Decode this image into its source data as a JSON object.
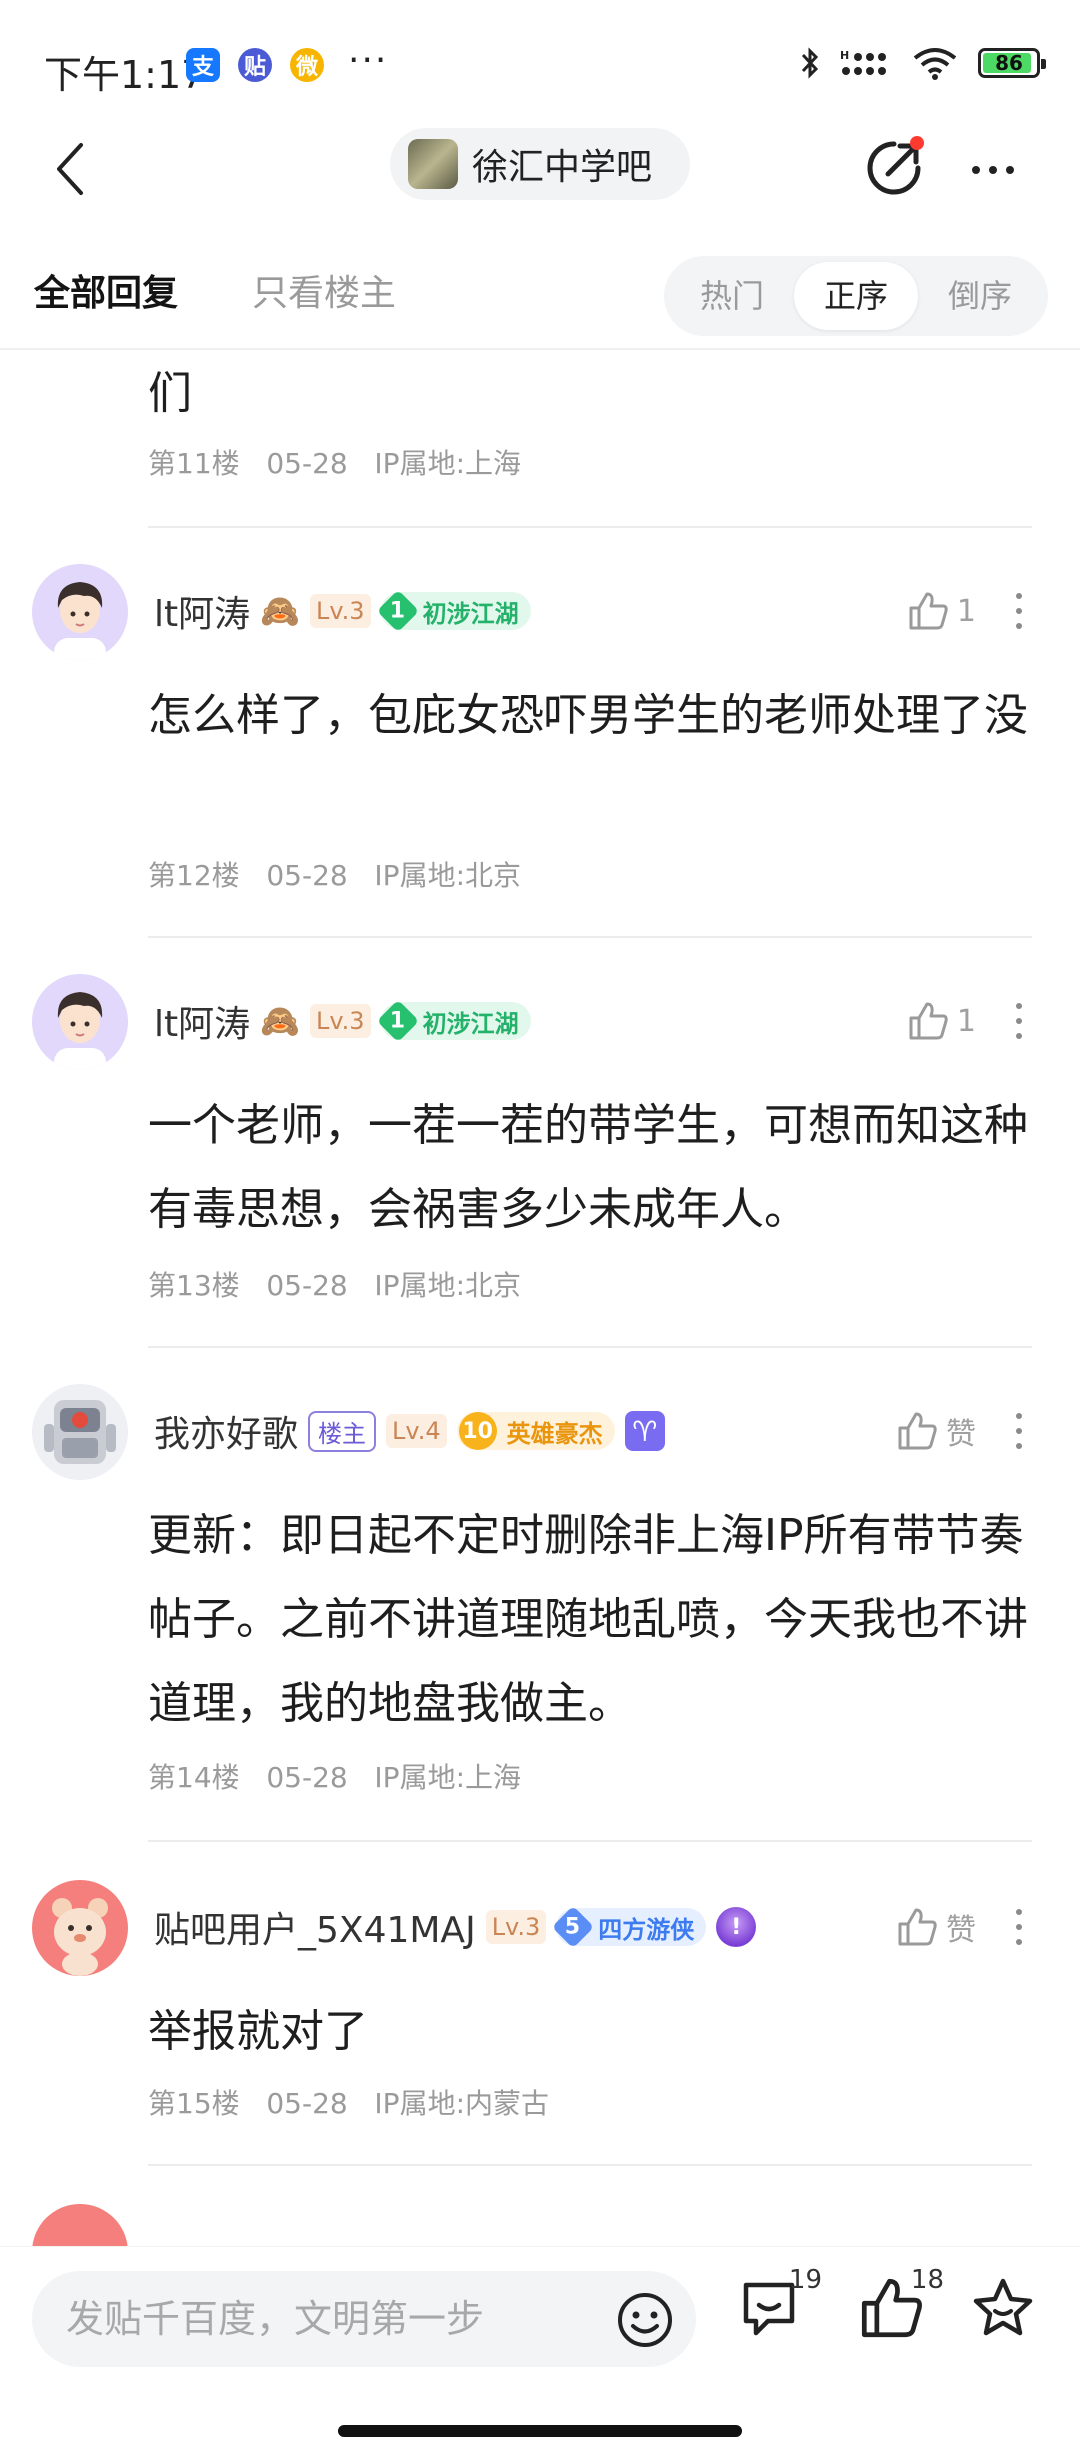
{
  "status_bar": {
    "time": "下午1:17",
    "app_icons": [
      "支",
      "贴",
      "微"
    ],
    "more": "···",
    "battery": "86"
  },
  "header": {
    "forum_name": "徐汇中学吧"
  },
  "tabs": {
    "all": "全部回复",
    "host_only": "只看楼主",
    "sort": [
      "热门",
      "正序",
      "倒序"
    ],
    "sort_active": "正序"
  },
  "posts": [
    {
      "content": "们",
      "floor": "第11楼",
      "date": "05-28",
      "ip": "IP属地:上海"
    },
    {
      "username": "lt阿涛",
      "emoji": "🙈",
      "level": "Lv.3",
      "rank_num": "1",
      "rank_name": "初涉江湖",
      "likes": "1",
      "content": "怎么样了，包庇女恐吓男学生的老师处理了没",
      "floor": "第12楼",
      "date": "05-28",
      "ip": "IP属地:北京"
    },
    {
      "username": "lt阿涛",
      "emoji": "🙈",
      "level": "Lv.3",
      "rank_num": "1",
      "rank_name": "初涉江湖",
      "likes": "1",
      "content": "一个老师，一茬一茬的带学生，可想而知这种有毒思想，会祸害多少未成年人。",
      "floor": "第13楼",
      "date": "05-28",
      "ip": "IP属地:北京"
    },
    {
      "username": "我亦好歌",
      "host_badge": "楼主",
      "level": "Lv.4",
      "rank_num": "10",
      "rank_name": "英雄豪杰",
      "zodiac": "♈",
      "likes": "赞",
      "content": "更新：即日起不定时删除非上海IP所有带节奏帖子。之前不讲道理随地乱喷，今天我也不讲道理，我的地盘我做主。",
      "floor": "第14楼",
      "date": "05-28",
      "ip": "IP属地:上海"
    },
    {
      "username": "贴吧用户_5X41MAJ",
      "level": "Lv.3",
      "rank_num": "5",
      "rank_name": "四方游侠",
      "likes": "赞",
      "content": "举报就对了",
      "floor": "第15楼",
      "date": "05-28",
      "ip": "IP属地:内蒙古"
    }
  ],
  "bottom_bar": {
    "placeholder": "发贴千百度，文明第一步",
    "comment_count": "19",
    "like_count": "18"
  },
  "icons": {
    "back": "chevron-left-icon",
    "share": "share-icon",
    "more": "more-icon",
    "like": "thumb-up-icon",
    "emoji": "smile-icon",
    "comment": "comment-icon",
    "favorite": "star-icon"
  }
}
